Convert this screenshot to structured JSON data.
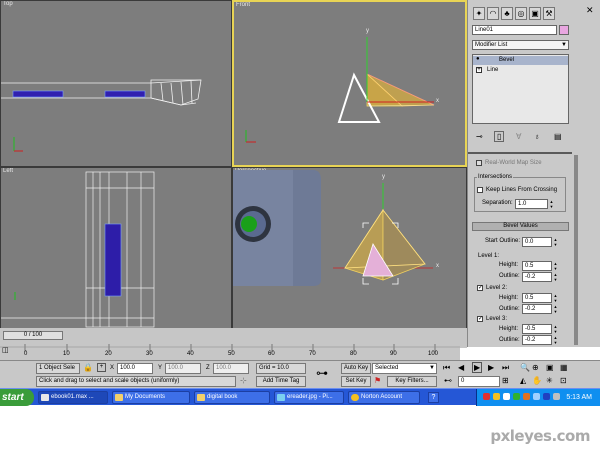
{
  "viewports": {
    "top": {
      "label": "Top"
    },
    "front": {
      "label": "Front"
    },
    "left": {
      "label": "Left"
    },
    "perspective": {
      "label": "Perspective"
    },
    "axis_y": "y",
    "axis_x": "x"
  },
  "panel": {
    "tabs": [
      "create-icon",
      "modify-icon",
      "hierarchy-icon",
      "motion-icon",
      "display-icon",
      "utilities-icon"
    ],
    "object_name": "Line01",
    "object_color": "#e8a6e0",
    "modifier_list_label": "Modifier List",
    "stack": [
      {
        "label": "Bevel",
        "selected": true
      },
      {
        "label": "Line",
        "selected": false
      }
    ],
    "real_world_map_size": "Real-World Map Size",
    "intersections_title": "Intersections",
    "keep_lines_label": "Keep Lines From Crossing",
    "separation_label": "Separation:",
    "separation_value": "1.0",
    "bevel_values_title": "Bevel Values",
    "start_outline_label": "Start Outline:",
    "start_outline_value": "0.0",
    "level1_label": "Level 1:",
    "level2_label": "Level 2:",
    "level3_label": "Level 3:",
    "height_label": "Height:",
    "outline_label": "Outline:",
    "level1": {
      "height": "0.5",
      "outline": "-0.2"
    },
    "level2": {
      "height": "0.5",
      "outline": "-0.2",
      "checked": true
    },
    "level3": {
      "height": "-0.5",
      "outline": "-0.2",
      "checked": true
    }
  },
  "timeline": {
    "frame_display": "0 / 100",
    "ticks": [
      "0",
      "10",
      "20",
      "30",
      "40",
      "50",
      "60",
      "70",
      "80",
      "90",
      "100"
    ]
  },
  "status": {
    "selection": "1 Object Sele",
    "prompt": "Click and drag to select and scale objects (uniformly)",
    "x_label": "X",
    "x_value": "100.0",
    "y_label": "Y",
    "y_value": "100.0",
    "z_label": "Z",
    "z_value": "100.0",
    "grid": "Grid = 10.0",
    "add_time_tag": "Add Time Tag",
    "auto_key": "Auto Key",
    "selected_mode": "Selected",
    "set_key": "Set Key",
    "key_filters": "Key Filters...",
    "frame_value": "0"
  },
  "taskbar": {
    "start": "start",
    "tasks": [
      "ebook01.max ...",
      "My Documents",
      "digital book",
      "ereader.jpg - Pi...",
      "Norton Account"
    ],
    "clock": "5:13 AM"
  },
  "watermark": "pxleyes.com"
}
